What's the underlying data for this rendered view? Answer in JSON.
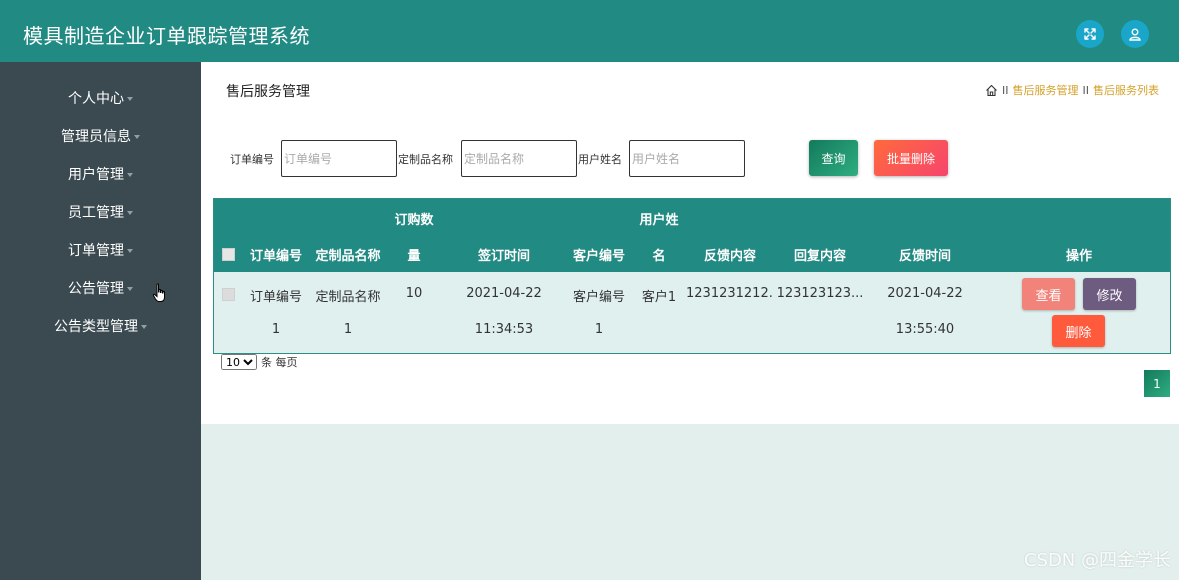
{
  "header": {
    "title": "模具制造企业订单跟踪管理系统",
    "fullscreen_icon": "fullscreen-icon",
    "user_icon": "user-icon"
  },
  "sidebar": {
    "items": [
      {
        "label": "个人中心"
      },
      {
        "label": "管理员信息"
      },
      {
        "label": "用户管理"
      },
      {
        "label": "员工管理"
      },
      {
        "label": "订单管理"
      },
      {
        "label": "公告管理"
      },
      {
        "label": "公告类型管理"
      }
    ]
  },
  "page": {
    "title": "售后服务管理",
    "breadcrumb": [
      "售后服务管理",
      "售后服务列表"
    ],
    "breadcrumb_sep": "II"
  },
  "search": {
    "order_no_label": "订单编号",
    "order_no_placeholder": "订单编号",
    "product_label": "定制品名称",
    "product_placeholder": "定制品名称",
    "user_label": "用户姓名",
    "user_placeholder": "用户姓名",
    "query_button": "查询",
    "batch_delete_button": "批量删除"
  },
  "table": {
    "headers": {
      "order_no": "订单编号",
      "product": "定制品名称",
      "quantity_1": "订购数",
      "quantity_2": "量",
      "sign_time": "签订时间",
      "customer_no": "客户编号",
      "username_1": "用户姓",
      "username_2": "名",
      "feedback": "反馈内容",
      "reply": "回复内容",
      "feedback_time": "反馈时间",
      "actions": "操作"
    },
    "rows": [
      {
        "order_no_1": "订单编号",
        "order_no_2": "1",
        "product_1": "定制品名称",
        "product_2": "1",
        "quantity": "10",
        "sign_time_1": "2021-04-22",
        "sign_time_2": "11:34:53",
        "customer_no_1": "客户编号",
        "customer_no_2": "1",
        "username": "客户1",
        "feedback": "1231231212...",
        "reply": "123123123...",
        "feedback_time_1": "2021-04-22",
        "feedback_time_2": "13:55:40",
        "view_button": "查看",
        "edit_button": "修改",
        "delete_button": "删除"
      }
    ]
  },
  "pager": {
    "page_size": "10",
    "page_size_suffix": "条 每页",
    "current_page": "1"
  },
  "watermark": "CSDN @四金学长",
  "colors": {
    "header_bg": "#218a83",
    "sidebar_bg": "#3b4a50",
    "breadcrumb": "#d4a12a",
    "view_button": "#f2837a",
    "edit_button": "#6e5b80",
    "delete_button": "#ff5a3c"
  }
}
